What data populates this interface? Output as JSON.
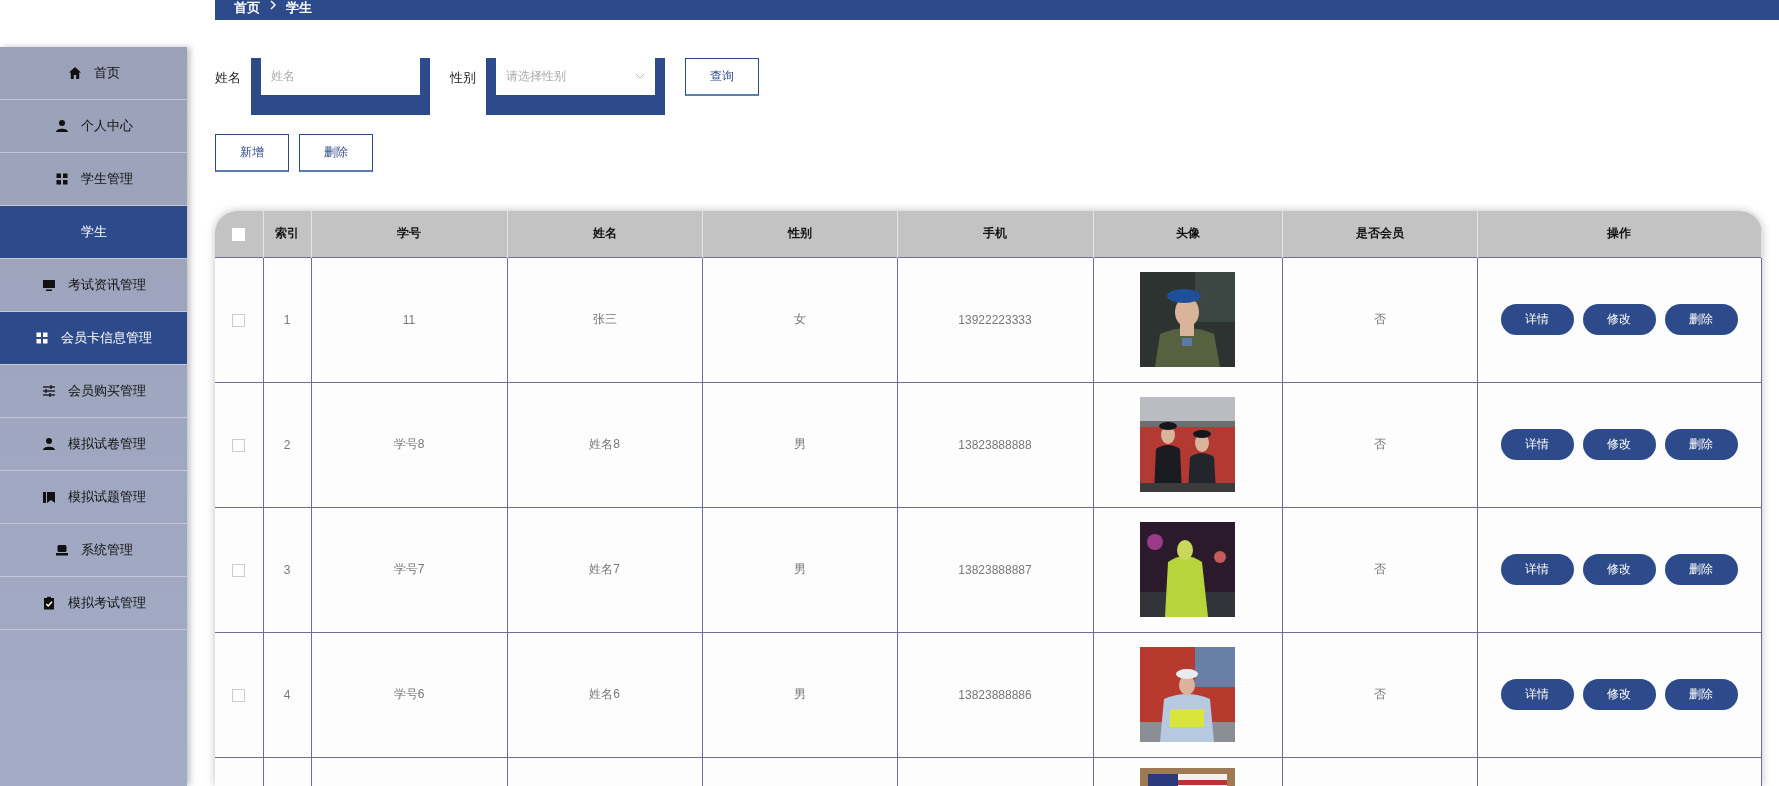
{
  "breadcrumb": [
    "首页",
    "学生"
  ],
  "sidebar": {
    "items": [
      {
        "label": "首页",
        "kind": "home",
        "selected": false
      },
      {
        "label": "个人中心",
        "kind": "person",
        "selected": false
      },
      {
        "label": "学生管理",
        "kind": "grid",
        "selected": false
      },
      {
        "label": "学生",
        "kind": "sub",
        "selected": true
      },
      {
        "label": "考试资讯管理",
        "kind": "monitor",
        "selected": false
      },
      {
        "label": "会员卡信息管理",
        "kind": "grid",
        "selected": true
      },
      {
        "label": "会员购买管理",
        "kind": "sliders",
        "selected": false
      },
      {
        "label": "模拟试卷管理",
        "kind": "person",
        "selected": false
      },
      {
        "label": "模拟试题管理",
        "kind": "book",
        "selected": false
      },
      {
        "label": "系统管理",
        "kind": "laptop",
        "selected": false
      },
      {
        "label": "模拟考试管理",
        "kind": "clipboard",
        "selected": false
      }
    ]
  },
  "search": {
    "fields": [
      {
        "label": "姓名",
        "kind": "input",
        "placeholder": "姓名"
      },
      {
        "label": "性别",
        "kind": "select",
        "placeholder": "请选择性别"
      }
    ],
    "button": "查询"
  },
  "actions": [
    "新增",
    "删除"
  ],
  "table": {
    "header_checked": false,
    "columns": [
      "索引",
      "学号",
      "姓名",
      "性别",
      "手机",
      "头像",
      "是否会员",
      "操作"
    ],
    "rows": [
      {
        "checked": false,
        "index": "1",
        "student_no": "11",
        "name": "张三",
        "gender": "女",
        "phone": "13922223333",
        "avatar": {
          "kind": "picture"
        },
        "member": "否",
        "operations": [
          "详情",
          "修改",
          "删除"
        ]
      },
      {
        "checked": false,
        "index": "2",
        "student_no": "学号8",
        "name": "姓名8",
        "gender": "男",
        "phone": "13823888888",
        "avatar": {
          "kind": "picture"
        },
        "member": "否",
        "operations": [
          "详情",
          "修改",
          "删除"
        ]
      },
      {
        "checked": false,
        "index": "3",
        "student_no": "学号7",
        "name": "姓名7",
        "gender": "男",
        "phone": "13823888887",
        "avatar": {
          "kind": "picture"
        },
        "member": "否",
        "operations": [
          "详情",
          "修改",
          "删除"
        ]
      },
      {
        "checked": false,
        "index": "4",
        "student_no": "学号6",
        "name": "姓名6",
        "gender": "男",
        "phone": "13823888886",
        "avatar": {
          "kind": "picture"
        },
        "member": "否",
        "operations": [
          "详情",
          "修改",
          "删除"
        ]
      }
    ],
    "cut_row": {
      "avatar": {
        "kind": "picture"
      }
    }
  }
}
